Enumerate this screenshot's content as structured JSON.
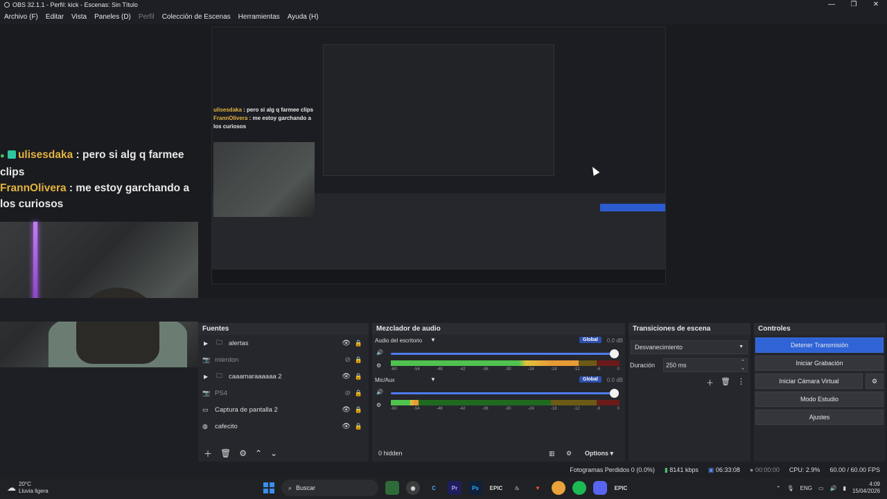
{
  "window": {
    "title": "OBS 32.1.1 - Perfil: kick - Escenas: Sin Título"
  },
  "menu": [
    {
      "label": "Archivo (F)",
      "disabled": false
    },
    {
      "label": "Editar",
      "disabled": false
    },
    {
      "label": "Vista",
      "disabled": false
    },
    {
      "label": "Paneles (D)",
      "disabled": false
    },
    {
      "label": "Perfil",
      "disabled": true
    },
    {
      "label": "Colección de Escenas",
      "disabled": false
    },
    {
      "label": "Herramientas",
      "disabled": false
    },
    {
      "label": "Ayuda (H)",
      "disabled": false
    }
  ],
  "preview": {
    "chat": [
      {
        "user": "ulisesdaka",
        "msg": " : pero si alg q farmee clips"
      },
      {
        "user": "FrannOlivera",
        "msg": " : me estoy garchando a los curiosos"
      }
    ]
  },
  "sources": {
    "title": "Fuentes",
    "items": [
      {
        "name": "alertas",
        "icon": "folder-icon",
        "group": true,
        "hidden": false
      },
      {
        "name": "mierdon",
        "icon": "camera-icon",
        "group": false,
        "hidden": true
      },
      {
        "name": "caaamaraaaaaa 2",
        "icon": "folder-icon",
        "group": true,
        "hidden": false
      },
      {
        "name": "PS4",
        "icon": "camera-icon",
        "group": false,
        "hidden": true
      },
      {
        "name": "Captura de pantalla 2",
        "icon": "monitor-icon",
        "group": false,
        "hidden": false
      },
      {
        "name": "cafecito",
        "icon": "globe-icon",
        "group": false,
        "hidden": false
      }
    ]
  },
  "mixer": {
    "title": "Mezclador de audio",
    "channels": [
      {
        "name": "Audio del escritorio",
        "mode": "Global",
        "db": "0.0 dB",
        "level": 0.82
      },
      {
        "name": "Mic/Aux",
        "mode": "Global",
        "db": "0.0 dB",
        "level": 0.12
      }
    ],
    "scale": [
      "-60",
      "-54",
      "-48",
      "-42",
      "-36",
      "-30",
      "-24",
      "-18",
      "-12",
      "-6",
      "0"
    ],
    "hidden_label": "0 hidden",
    "options_label": "Options"
  },
  "transitions": {
    "title": "Transiciones de escena",
    "selected": "Desvanecimiento",
    "duration_label": "Duración",
    "duration": "250 ms"
  },
  "controls": {
    "title": "Controles",
    "stop_stream": "Detener Transmisión",
    "start_record": "Iniciar Grabación",
    "virtual_cam": "Iniciar Cámara Virtual",
    "studio": "Modo Estudio",
    "settings": "Ajustes"
  },
  "status": {
    "dropped": "Fotogramas Perdidos 0 (0.0%)",
    "bitrate": "8141 kbps",
    "stream_time": "06:33:08",
    "rec_time": "00:00:00",
    "cpu": "CPU: 2.9%",
    "fps": "60.00 / 60.00 FPS"
  },
  "taskbar": {
    "temp": "20°C",
    "weather": "Lluvia ligera",
    "search": "Buscar",
    "lang": "ENG",
    "time": "4:09",
    "date": "15/04/2026"
  }
}
